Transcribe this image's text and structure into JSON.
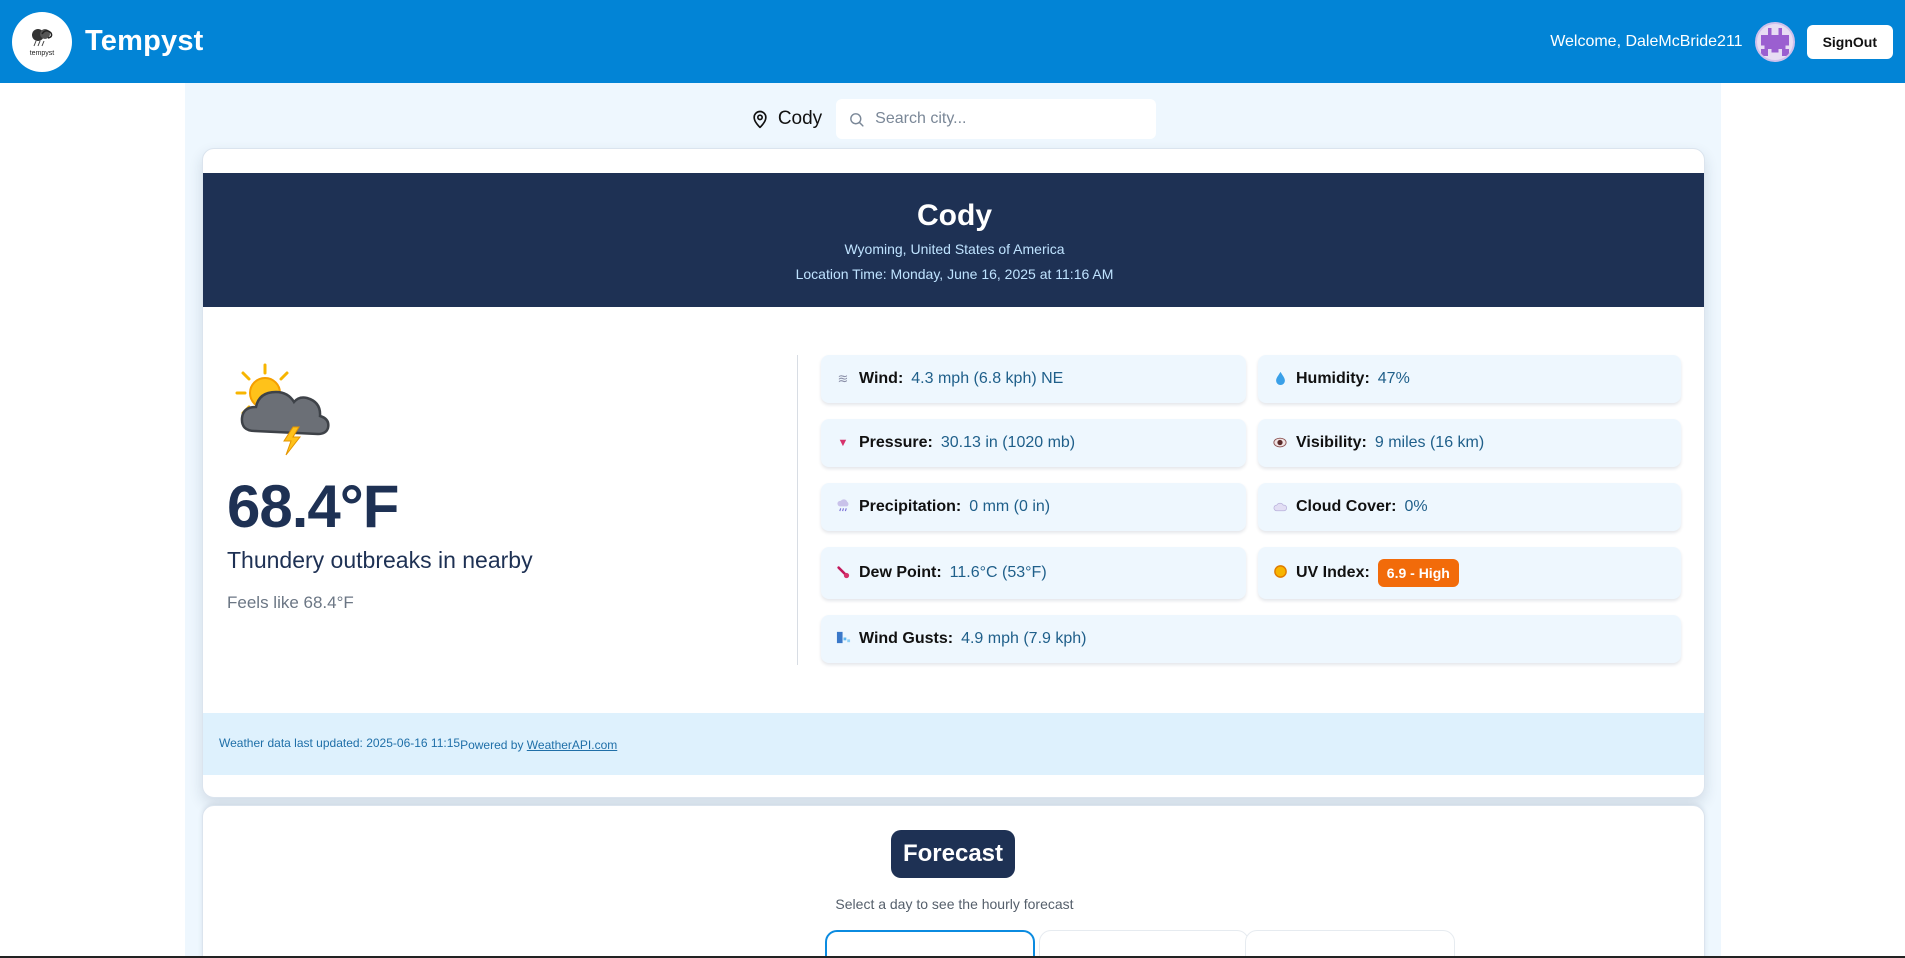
{
  "header": {
    "brand_name": "Tempyst",
    "logo_text": "tempyst",
    "welcome": "Welcome, DaleMcBride211",
    "signout_label": "SignOut"
  },
  "search": {
    "current_location": "Cody",
    "placeholder": "Search city..."
  },
  "weather": {
    "city": "Cody",
    "region": "Wyoming, United States of America",
    "location_time": "Location Time: Monday, June 16, 2025 at 11:16 AM",
    "temperature": "68.4°F",
    "condition": "Thundery outbreaks in nearby",
    "feels_like": "Feels like 68.4°F",
    "stats": {
      "wind": {
        "label": "Wind:",
        "value": "4.3 mph (6.8 kph) NE",
        "icon": "wind-icon"
      },
      "humidity": {
        "label": "Humidity:",
        "value": "47%",
        "icon": "droplet-icon"
      },
      "pressure": {
        "label": "Pressure:",
        "value": "30.13 in (1020 mb)",
        "icon": "triangle-down-icon"
      },
      "visibility": {
        "label": "Visibility:",
        "value": "9 miles (16 km)",
        "icon": "eye-icon"
      },
      "precipitation": {
        "label": "Precipitation:",
        "value": "0 mm (0 in)",
        "icon": "rain-cloud-icon"
      },
      "cloud_cover": {
        "label": "Cloud Cover:",
        "value": "0%",
        "icon": "cloud-icon"
      },
      "dew_point": {
        "label": "Dew Point:",
        "value": "11.6°C (53°F)",
        "icon": "thermometer-icon"
      },
      "uv_index": {
        "label": "UV Index:",
        "value": "6.9 - High",
        "icon": "sun-icon"
      },
      "wind_gusts": {
        "label": "Wind Gusts:",
        "value": "4.9 mph (7.9 kph)",
        "icon": "gust-icon"
      }
    },
    "footer": {
      "last_updated": "Weather data last updated: 2025-06-16 11:15",
      "powered_by": "Powered by ",
      "provider_link": "WeatherAPI.com"
    }
  },
  "forecast": {
    "title": "Forecast",
    "subtitle": "Select a day to see the hourly forecast"
  },
  "colors": {
    "header_bg": "#0284d6",
    "hero_bg": "#1e3154",
    "uv_badge": "#f26b0a",
    "stat_bg": "#eef7fe"
  }
}
